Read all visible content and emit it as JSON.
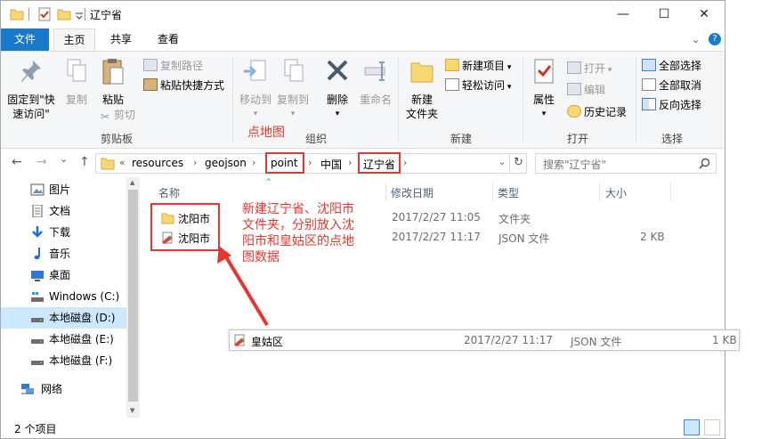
{
  "window": {
    "title": "辽宁省",
    "controls": {
      "minimize": "—",
      "maximize": "☐",
      "close": "✕"
    }
  },
  "tabs": {
    "file": "文件",
    "home": "主页",
    "share": "共享",
    "view": "查看"
  },
  "ribbon": {
    "help": "?",
    "clipboard": {
      "pin_line1": "固定到\"快",
      "pin_line2": "速访问\"",
      "copy": "复制",
      "paste": "粘贴",
      "copy_path": "复制路径",
      "paste_shortcut": "粘贴快捷方式",
      "cut": "剪切",
      "label": "剪贴板"
    },
    "organize": {
      "move_to": "移动到",
      "copy_to": "复制到",
      "delete": "删除",
      "rename": "重命名",
      "label": "组织"
    },
    "new": {
      "new_folder_line1": "新建",
      "new_folder_line2": "文件夹",
      "new_item": "新建项目",
      "easy_access": "轻松访问",
      "label": "新建"
    },
    "open": {
      "properties": "属性",
      "open": "打开",
      "edit": "编辑",
      "history": "历史记录",
      "label": "打开"
    },
    "select": {
      "select_all": "全部选择",
      "select_none": "全部取消",
      "invert": "反向选择",
      "label": "选择"
    }
  },
  "nav": {
    "back": "←",
    "forward": "→",
    "recent": "⌄",
    "up": "↑",
    "breadcrumb": [
      "«",
      "resources",
      "geojson",
      "point",
      "中国",
      "辽宁省"
    ],
    "refresh": "↻",
    "search_placeholder": "搜索\"辽宁省\"",
    "search_icon": "search-icon"
  },
  "navpane": {
    "items": [
      {
        "label": "图片",
        "icon": "pictures-icon"
      },
      {
        "label": "文档",
        "icon": "documents-icon"
      },
      {
        "label": "下载",
        "icon": "downloads-icon"
      },
      {
        "label": "音乐",
        "icon": "music-icon"
      },
      {
        "label": "桌面",
        "icon": "desktop-icon"
      },
      {
        "label": "Windows (C:)",
        "icon": "drive-icon"
      },
      {
        "label": "本地磁盘 (D:)",
        "icon": "drive-icon"
      },
      {
        "label": "本地磁盘 (E:)",
        "icon": "drive-icon"
      },
      {
        "label": "本地磁盘 (F:)",
        "icon": "drive-icon"
      },
      {
        "label": "网络",
        "icon": "network-icon"
      }
    ]
  },
  "filelist": {
    "columns": [
      "名称",
      "修改日期",
      "类型",
      "大小"
    ],
    "rows": [
      {
        "name": "沈阳市",
        "date": "2017/2/27 11:05",
        "type": "文件夹",
        "size": ""
      },
      {
        "name": "沈阳市",
        "date": "2017/2/27 11:17",
        "type": "JSON 文件",
        "size": "2 KB"
      }
    ],
    "popup_row": {
      "name": "皇姑区",
      "date": "2017/2/27 11:17",
      "type": "JSON 文件",
      "size": "1 KB"
    }
  },
  "status": {
    "count": "2 个项目"
  },
  "annotations": {
    "point_label": "点地图",
    "note_line1": "新建辽宁省、沈阳市",
    "note_line2": "文件夹，分别放入沈",
    "note_line3": "阳市和皇姑区的点地",
    "note_line4": "图数据",
    "color": "#e8352d"
  },
  "colors": {
    "accent": "#1979ca",
    "selection": "#cce8ff"
  }
}
